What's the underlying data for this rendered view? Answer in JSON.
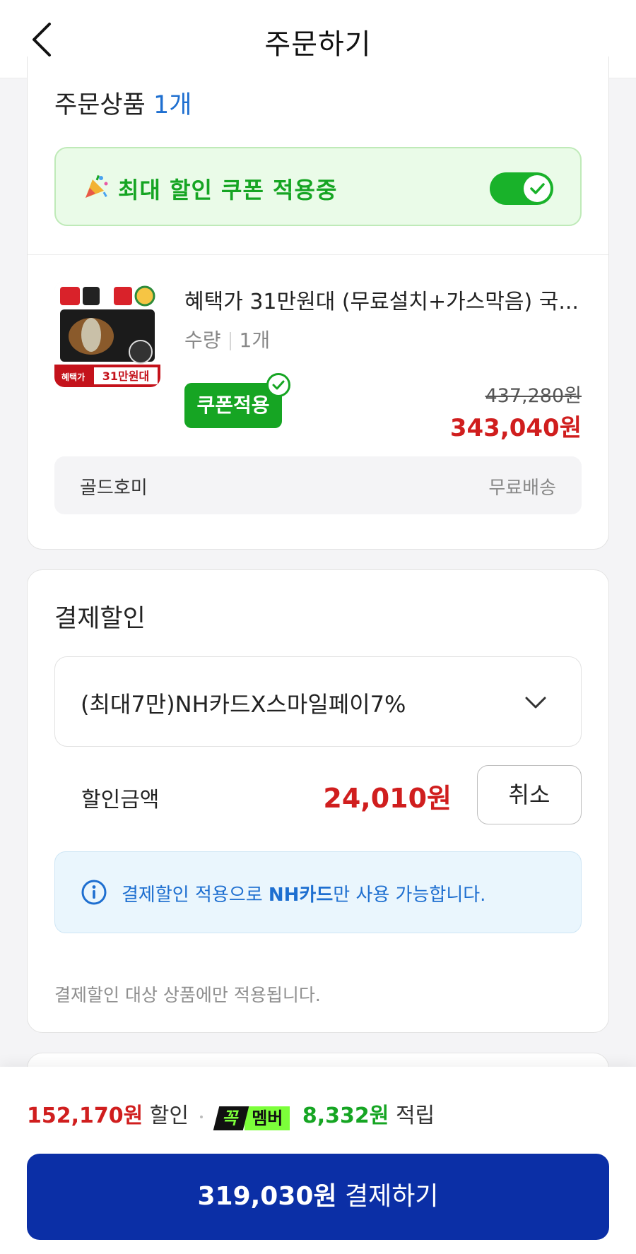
{
  "header": {
    "title": "주문하기"
  },
  "products_section": {
    "title": "주문상품",
    "count": "1개",
    "coupon_banner_text": "최대 할인 쿠폰 적용중",
    "coupon_toggle_on": true,
    "product": {
      "name": "혜택가 31만원대 (무료설치+가스막음) 국...",
      "qty_label": "수량",
      "qty_value": "1개",
      "coupon_badge": "쿠폰적용",
      "original_price": "437,280원",
      "final_price": "343,040원",
      "thumb_text_bottom_left": "혜택가",
      "thumb_text_bottom_right": "31만원대"
    },
    "seller": {
      "name": "골드호미",
      "shipping": "무료배송"
    }
  },
  "payment_section": {
    "title": "결제할인",
    "selected_card": "(최대7만)NH카드X스마일페이7%",
    "discount_label": "할인금액",
    "discount_amount": "24,010원",
    "cancel_label": "취소",
    "notice_prefix": "결제할인 적용으로 ",
    "notice_bold": "NH카드",
    "notice_suffix": "만 사용 가능합니다.",
    "footnote": "결제할인 대상 상품에만 적용됩니다."
  },
  "bottom_bar": {
    "discount_total": "152,170원",
    "discount_word": "할인",
    "member_badge_left": "꼭",
    "member_badge_right": "멤버",
    "points": "8,332원",
    "points_word": "적립",
    "pay_amount": "319,030원",
    "pay_label": "결제하기"
  },
  "colors": {
    "accent_blue": "#1e6fd0",
    "price_red": "#d01e1e",
    "coupon_green": "#16a523",
    "pay_button": "#0b2fa6"
  }
}
